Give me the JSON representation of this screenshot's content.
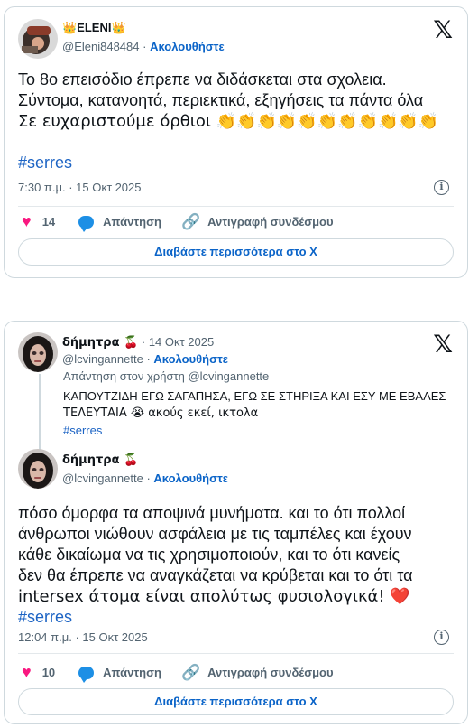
{
  "tweet1": {
    "display_name": "👑ELENI👑",
    "handle": "@Eleni848484",
    "follow_label": "Ακολουθήστε",
    "text_lines": [
      "Το 8ο επεισόδιο έπρεπε να διδάσκεται στα σχολεια.",
      "Σύντομα, κατανοητά, περιεκτικά, εξηγήσεις τα πάντα όλα",
      "Σε ευχαριστούμε όρθιοι 👏👏👏👏👏👏👏👏👏👏👏"
    ],
    "hashtag": "#serres",
    "timestamp": "7:30 π.μ. · 15 Οκτ 2025",
    "likes": "14",
    "reply_label": "Απάντηση",
    "copy_link_label": "Αντιγραφή συνδέσμου",
    "read_more_label": "Διαβάστε περισσότερα στο X"
  },
  "tweet2": {
    "parent": {
      "display_name": "δήμητρα 🍒",
      "date": "· 14 Οκτ 2025",
      "handle": "@lcvingannette",
      "follow_label": "Ακολουθήστε",
      "reply_to": "Απάντηση στον χρήστη @lcvingannette",
      "text_line1": "ΚΑΠΟΥΤΖΙΔΗ ΕΓΩ ΣΑΓΑΠΗΣΑ, ΕΓΩ ΣΕ ΣΤΗΡΙΞΑ ΚΑΙ ΕΣΥ ΜΕ ΕΒΑΛΕΣ",
      "text_line2": "ΤΕΛΕΥΤΑΙΑ 😭 ακούς εκεί, ικτολα",
      "hashtag": "#serres"
    },
    "display_name": "δήμητρα 🍒",
    "handle": "@lcvingannette",
    "follow_label": "Ακολουθήστε",
    "text_lines": [
      "πόσο όμορφα τα αποψινά μυνήματα. και το ότι πολλοί",
      "άνθρωποι νιώθουν ασφάλεια με τις ταμπέλες και έχουν",
      "κάθε δικαίωμα να τις χρησιμοποιούν, και το ότι κανείς",
      "δεν θα έπρεπε να αναγκάζεται να κρύβεται και το ότι τα",
      "intersex άτομα είναι απολύτως φυσιολογικά! ❤️"
    ],
    "hashtag": "#serres",
    "timestamp": "12:04 π.μ. · 15 Οκτ 2025",
    "likes": "10",
    "reply_label": "Απάντηση",
    "copy_link_label": "Αντιγραφή συνδέσμου",
    "read_more_label": "Διαβάστε περισσότερα στο X"
  },
  "icons": {
    "x_logo": "𝕏",
    "heart": "♥",
    "link": "🔗",
    "info": "i",
    "separator": "·"
  },
  "colors": {
    "accent": "#0b64c8",
    "heart": "#f91880",
    "reply_bubble": "#1d8fe5",
    "secondary_text": "#536471",
    "border": "#cfd9de"
  }
}
